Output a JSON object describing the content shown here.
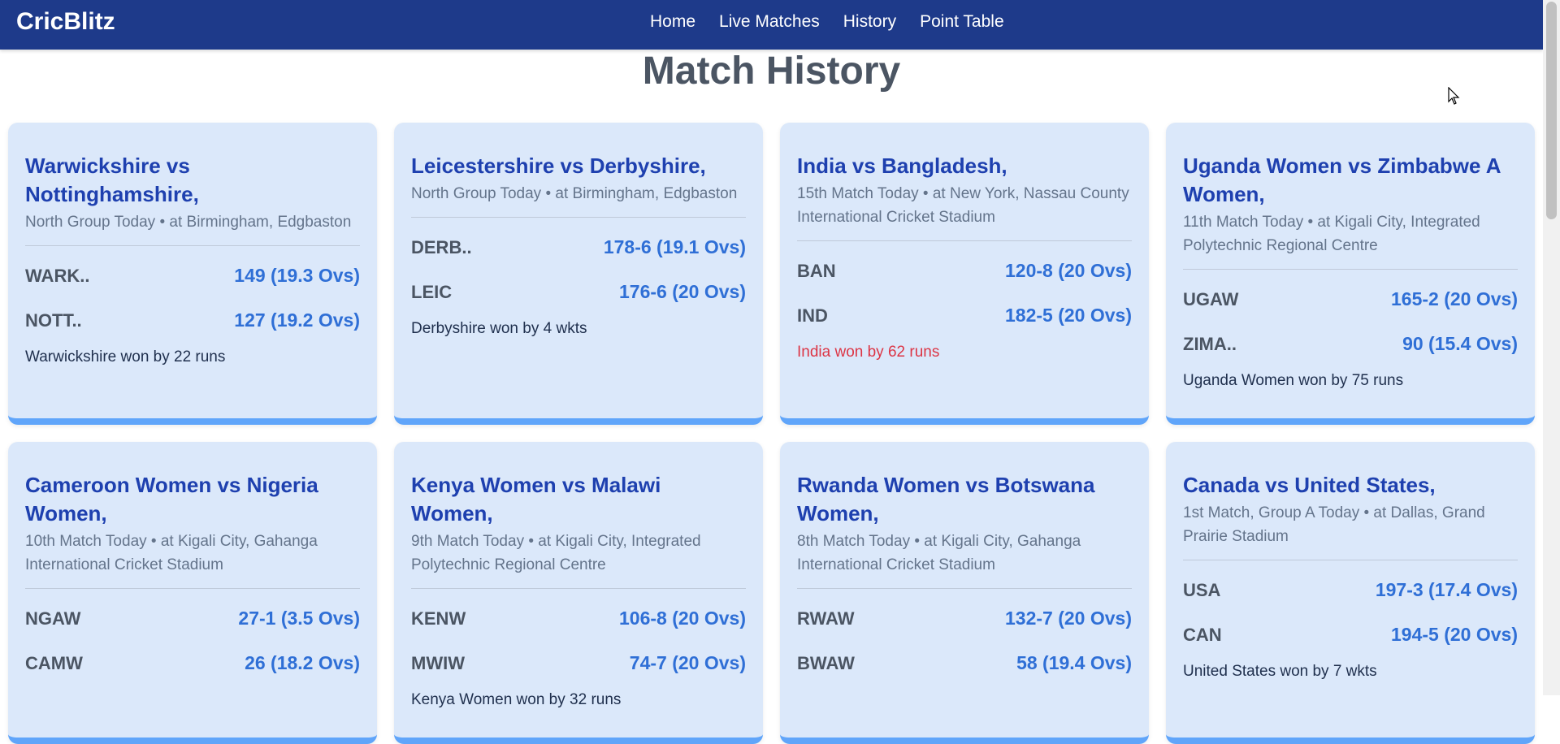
{
  "app": {
    "brand": "CricBlitz",
    "nav": [
      "Home",
      "Live Matches",
      "History",
      "Point Table"
    ]
  },
  "page_title": "Match History",
  "matches": [
    {
      "title": "Warwickshire vs Nottinghamshire,",
      "sub": "North Group Today • at Birmingham, Edgbaston",
      "teams": [
        {
          "abbr": "WARK..",
          "score": "149 (19.3 Ovs)"
        },
        {
          "abbr": "NOTT..",
          "score": "127 (19.2 Ovs)"
        }
      ],
      "result": "Warwickshire won by 22 runs",
      "highlight": false
    },
    {
      "title": "Leicestershire vs Derbyshire,",
      "sub": "North Group Today • at Birmingham, Edgbaston",
      "teams": [
        {
          "abbr": "DERB..",
          "score": "178-6 (19.1 Ovs)"
        },
        {
          "abbr": "LEIC",
          "score": "176-6 (20 Ovs)"
        }
      ],
      "result": "Derbyshire won by 4 wkts",
      "highlight": false
    },
    {
      "title": "India vs Bangladesh,",
      "sub": "15th Match Today • at New York, Nassau County International Cricket Stadium",
      "teams": [
        {
          "abbr": "BAN",
          "score": "120-8 (20 Ovs)"
        },
        {
          "abbr": "IND",
          "score": "182-5 (20 Ovs)"
        }
      ],
      "result": "India won by 62 runs",
      "highlight": true
    },
    {
      "title": "Uganda Women vs Zimbabwe A Women,",
      "sub": "11th Match Today • at Kigali City, Integrated Polytechnic Regional Centre",
      "teams": [
        {
          "abbr": "UGAW",
          "score": "165-2 (20 Ovs)"
        },
        {
          "abbr": "ZIMA..",
          "score": "90 (15.4 Ovs)"
        }
      ],
      "result": "Uganda Women won by 75 runs",
      "highlight": false
    },
    {
      "title": "Cameroon Women vs Nigeria Women,",
      "sub": "10th Match Today • at Kigali City, Gahanga International Cricket Stadium",
      "teams": [
        {
          "abbr": "NGAW",
          "score": "27-1 (3.5 Ovs)"
        },
        {
          "abbr": "CAMW",
          "score": "26 (18.2 Ovs)"
        }
      ],
      "result": "",
      "highlight": false
    },
    {
      "title": "Kenya Women vs Malawi Women,",
      "sub": "9th Match Today • at Kigali City, Integrated Polytechnic Regional Centre",
      "teams": [
        {
          "abbr": "KENW",
          "score": "106-8 (20 Ovs)"
        },
        {
          "abbr": "MWIW",
          "score": "74-7 (20 Ovs)"
        }
      ],
      "result": "Kenya Women won by 32 runs",
      "highlight": false
    },
    {
      "title": "Rwanda Women vs Botswana Women,",
      "sub": "8th Match Today • at Kigali City, Gahanga International Cricket Stadium",
      "teams": [
        {
          "abbr": "RWAW",
          "score": "132-7 (20 Ovs)"
        },
        {
          "abbr": "BWAW",
          "score": "58 (19.4 Ovs)"
        }
      ],
      "result": "",
      "highlight": false
    },
    {
      "title": "Canada vs United States,",
      "sub": "1st Match, Group A Today • at Dallas, Grand Prairie Stadium",
      "teams": [
        {
          "abbr": "USA",
          "score": "197-3 (17.4 Ovs)"
        },
        {
          "abbr": "CAN",
          "score": "194-5 (20 Ovs)"
        }
      ],
      "result": "United States won by 7 wkts",
      "highlight": false
    }
  ],
  "colors": {
    "navbar": "#1e3a8a",
    "card_bg": "#dbe8fa",
    "card_accent": "#60a5fa",
    "title": "#1e40af",
    "score": "#2f6fd6",
    "result_highlight": "#dc3545"
  }
}
